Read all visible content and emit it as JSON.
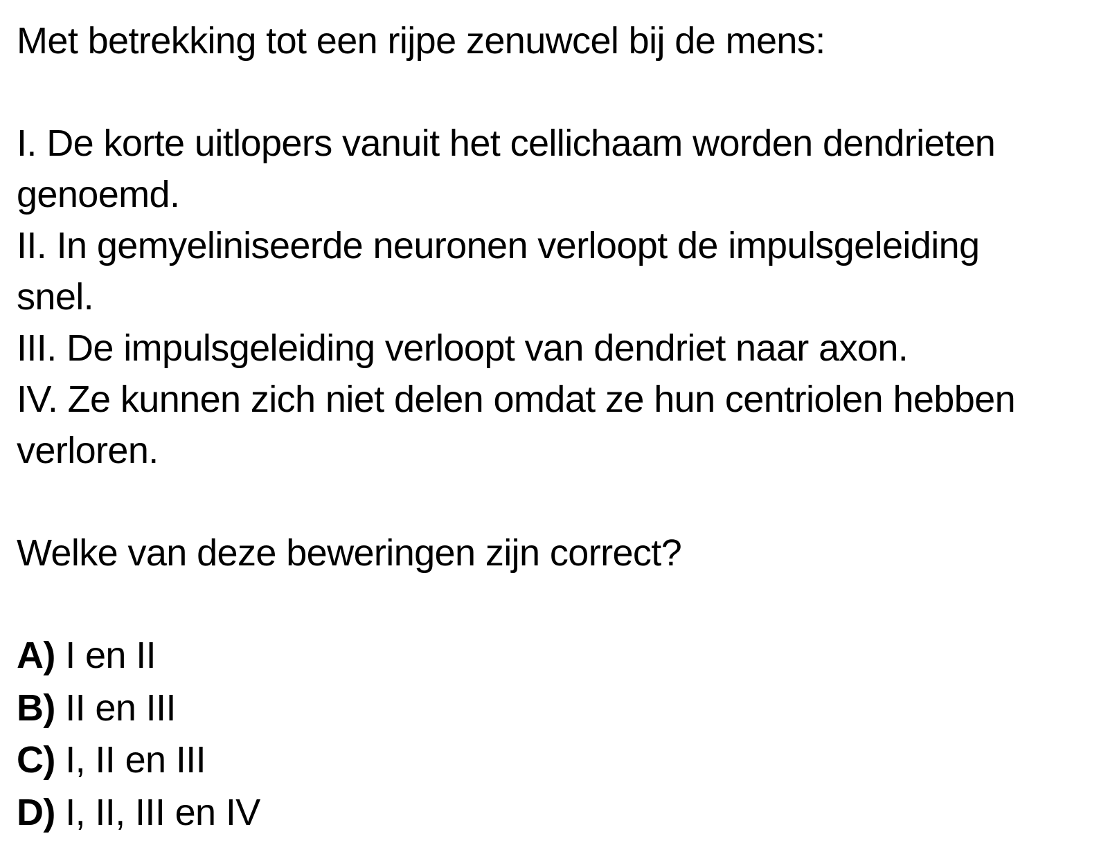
{
  "question": {
    "intro": "Met betrekking tot een rijpe zenuwcel bij de mens:",
    "statements": [
      [
        "I. De korte uitlopers vanuit het cellichaam worden dendrieten",
        "genoemd."
      ],
      [
        "II. In gemyeliniseerde neuronen verloopt de impulsgeleiding",
        "snel."
      ],
      [
        "III. De impulsgeleiding verloopt van dendriet naar axon."
      ],
      [
        "IV. Ze kunnen zich niet delen omdat ze hun centriolen hebben",
        "verloren."
      ]
    ],
    "prompt": "Welke van deze beweringen zijn correct?"
  },
  "options": [
    {
      "letter": "A)",
      "text": "I en II"
    },
    {
      "letter": "B)",
      "text": "II en III"
    },
    {
      "letter": "C)",
      "text": "I, II en III"
    },
    {
      "letter": "D)",
      "text": "I, II, III en IV"
    }
  ]
}
